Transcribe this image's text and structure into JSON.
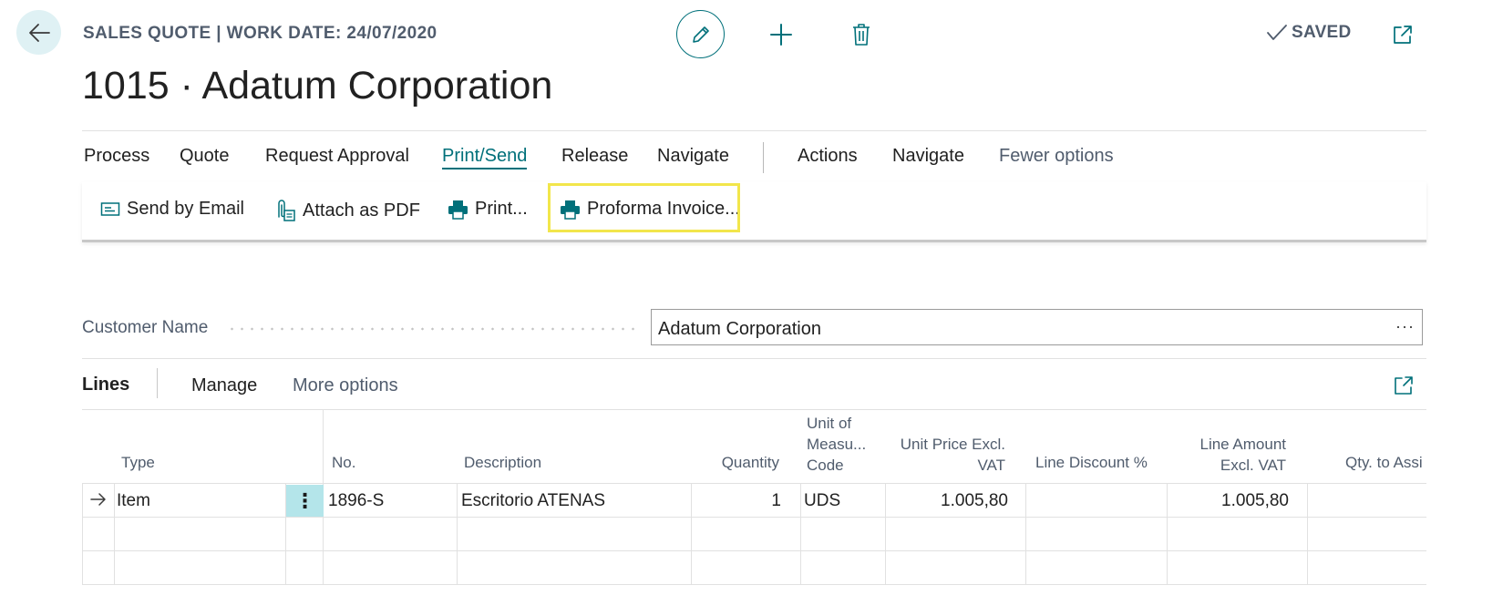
{
  "header": {
    "caption": "SALES QUOTE | WORK DATE: 24/07/2020",
    "title": "1015 · Adatum Corporation",
    "status": "SAVED",
    "icons": {
      "back": "arrow-left-icon",
      "edit": "pencil-icon",
      "new": "plus-icon",
      "delete": "trash-icon",
      "status": "checkmark-icon",
      "popout": "open-in-new-window-icon"
    }
  },
  "action_bar": {
    "items": [
      {
        "label": "Process"
      },
      {
        "label": "Quote"
      },
      {
        "label": "Request Approval"
      },
      {
        "label": "Print/Send",
        "active": true
      },
      {
        "label": "Release"
      },
      {
        "label": "Navigate"
      },
      {
        "label": "Actions"
      },
      {
        "label": "Navigate"
      },
      {
        "label": "Fewer options"
      }
    ],
    "submenu": [
      {
        "label": "Send by Email",
        "icon": "email-icon"
      },
      {
        "label": "Attach as PDF",
        "icon": "attach-pdf-icon"
      },
      {
        "label": "Print...",
        "icon": "printer-icon"
      },
      {
        "label": "Proforma Invoice...",
        "icon": "printer-icon",
        "highlighted": true
      }
    ]
  },
  "customer": {
    "label": "Customer Name",
    "value": "Adatum Corporation",
    "lookup": "···"
  },
  "lines": {
    "title": "Lines",
    "manage": "Manage",
    "more_options": "More options",
    "columns": {
      "type": "Type",
      "no": "No.",
      "description": "Description",
      "quantity": "Quantity",
      "uom_1": "Unit of",
      "uom_2": "Measu...",
      "uom_3": "Code",
      "price_1": "Unit Price Excl.",
      "price_2": "VAT",
      "discount": "Line Discount %",
      "amount_1": "Line Amount",
      "amount_2": "Excl. VAT",
      "qty_assign": "Qty. to Assi"
    },
    "rows": [
      {
        "type": "Item",
        "no": "1896-S",
        "description": "Escritorio ATENAS",
        "quantity": "1",
        "uom": "UDS",
        "unit_price": "1.005,80",
        "discount": "",
        "amount": "1.005,80",
        "qty_assign": ""
      }
    ],
    "row_actions": "⋮"
  },
  "colors": {
    "accent": "#00707a",
    "highlight": "#f2e64b",
    "selected_cell": "#b4e5ea",
    "back_button": "#dff1f4"
  }
}
